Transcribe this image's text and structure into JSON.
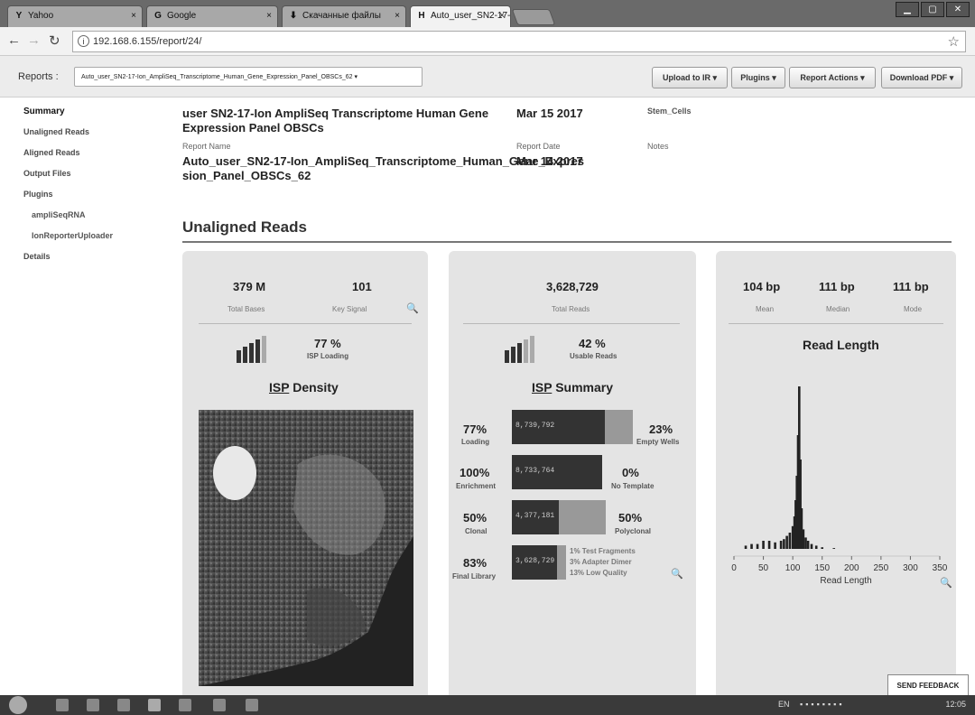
{
  "browser": {
    "tabs": [
      {
        "label": "Yahoo",
        "favicon": "Y"
      },
      {
        "label": "Google",
        "favicon": "G"
      },
      {
        "label": "Скачанные файлы",
        "favicon": "⬇"
      },
      {
        "label": "Auto_user_SN2-17-Ion_A",
        "favicon": "H"
      }
    ],
    "url": "192.168.6.155/report/24/"
  },
  "toolbar": {
    "reports_label": "Reports :",
    "report_select": "Auto_user_SN2-17-Ion_AmpliSeq_Transcriptome_Human_Gene_Expression_Panel_OBSCs_62 ▾",
    "buttons": [
      "Upload to IR ▾",
      "Plugins ▾",
      "Report Actions ▾",
      "Download PDF ▾"
    ]
  },
  "sidebar": {
    "items": [
      "Summary",
      "Unaligned Reads",
      "Aligned Reads",
      "Output Files",
      "Plugins",
      "ampliSeqRNA",
      "IonReporterUploader",
      "Details"
    ]
  },
  "header": {
    "run_name": "user SN2-17-Ion AmpliSeq Transcriptome Human Gene Expression Panel OBSCs",
    "run_date": "Mar 15 2017",
    "sample": "Stem_Cells",
    "report_name_label": "Report Name",
    "report_name": "Auto_user_SN2-17-Ion_AmpliSeq_Transcriptome_Human_Gene_Expression_Panel_OBSCs_62",
    "report_date_label": "Report Date",
    "report_date": "Mar 14 2017",
    "notes_label": "Notes"
  },
  "section_title": "Unaligned Reads",
  "card1": {
    "total_bases": "379 M",
    "total_bases_label": "Total Bases",
    "key_signal": "101",
    "key_signal_label": "Key Signal",
    "loading_pct": "77 %",
    "loading_label": "ISP Loading",
    "title_prefix": "ISP",
    "title_suffix": " Density"
  },
  "card2": {
    "total_reads": "3,628,729",
    "total_reads_label": "Total Reads",
    "usable_pct": "42 %",
    "usable_label": "Usable Reads",
    "title_prefix": "ISP",
    "title_suffix": " Summary",
    "rows": [
      {
        "pct": "77%",
        "label": "Loading",
        "value": "8,739,792",
        "fill": 0.77,
        "rpct": "23%",
        "rlabel": "Empty Wells"
      },
      {
        "pct": "100%",
        "label": "Enrichment",
        "value": "8,733,764",
        "fill": 1.0,
        "rpct": "0%",
        "rlabel": "No Template"
      },
      {
        "pct": "50%",
        "label": "Clonal",
        "value": "4,377,181",
        "fill": 0.5,
        "rpct": "50%",
        "rlabel": "Polyclonal"
      },
      {
        "pct": "83%",
        "label": "Final Library",
        "value": "3,628,729",
        "fill": 0.83,
        "notes": [
          "1% Test Fragments",
          "3% Adapter Dimer",
          "13% Low Quality"
        ]
      }
    ]
  },
  "card3": {
    "mean": "104 bp",
    "mean_label": "Mean",
    "median": "111 bp",
    "median_label": "Median",
    "mode": "111 bp",
    "mode_label": "Mode",
    "title": "Read Length"
  },
  "chart_data": {
    "type": "bar",
    "title": "Read Length",
    "xlabel": "Read Length",
    "ylabel": "",
    "xlim": [
      0,
      350
    ],
    "x_ticks": [
      0,
      50,
      100,
      150,
      200,
      250,
      300,
      350
    ],
    "x": [
      20,
      30,
      40,
      50,
      60,
      70,
      80,
      85,
      90,
      95,
      100,
      103,
      105,
      107,
      109,
      111,
      113,
      115,
      118,
      122,
      126,
      132,
      140,
      150,
      170
    ],
    "values": [
      0.02,
      0.03,
      0.03,
      0.05,
      0.05,
      0.04,
      0.05,
      0.06,
      0.08,
      0.1,
      0.14,
      0.2,
      0.3,
      0.45,
      0.7,
      1.0,
      0.55,
      0.25,
      0.12,
      0.07,
      0.05,
      0.03,
      0.02,
      0.01,
      0.005
    ]
  },
  "feedback": "SEND FEEDBACK",
  "taskbar": {
    "lang": "EN",
    "time": "12:05"
  }
}
